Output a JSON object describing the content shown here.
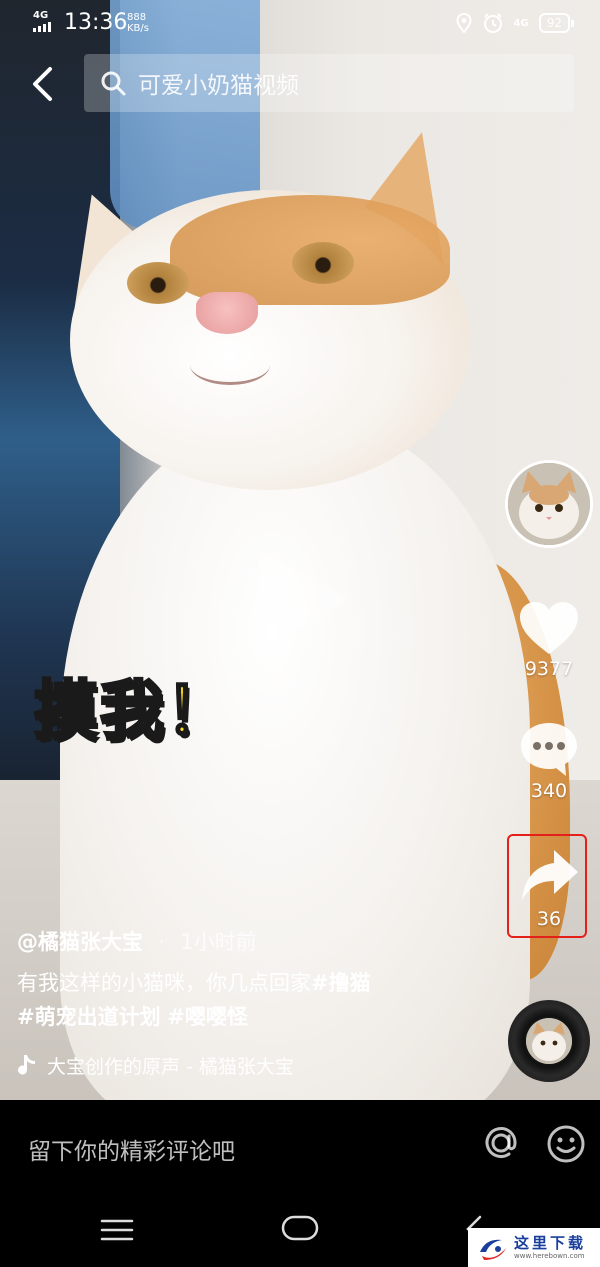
{
  "status_bar": {
    "network": "4G",
    "time": "13:36",
    "speed_value": "888",
    "speed_unit": "KB/s",
    "network_right": "4G",
    "battery": "92"
  },
  "header": {
    "search_text": "可爱小奶猫视频"
  },
  "video": {
    "sticker_text": "摸我！"
  },
  "actions": {
    "like_count": "9377",
    "comment_count": "340",
    "share_count": "36"
  },
  "caption": {
    "author": "@橘猫张大宝",
    "separator": "·",
    "posted": "1小时前",
    "text": "有我这样的小猫咪，你几点回家",
    "tags": [
      "#撸猫",
      "#萌宠出道计划",
      "#嘤嘤怪"
    ],
    "music": "大宝创作的原声 - 橘猫张大宝"
  },
  "comment_bar": {
    "placeholder": "留下你的精彩评论吧"
  },
  "watermark": {
    "cn": "这里下载",
    "en": "www.herebown.com"
  },
  "colors": {
    "highlight": "#e4201b",
    "sticker_fill": "#ffe11a"
  }
}
